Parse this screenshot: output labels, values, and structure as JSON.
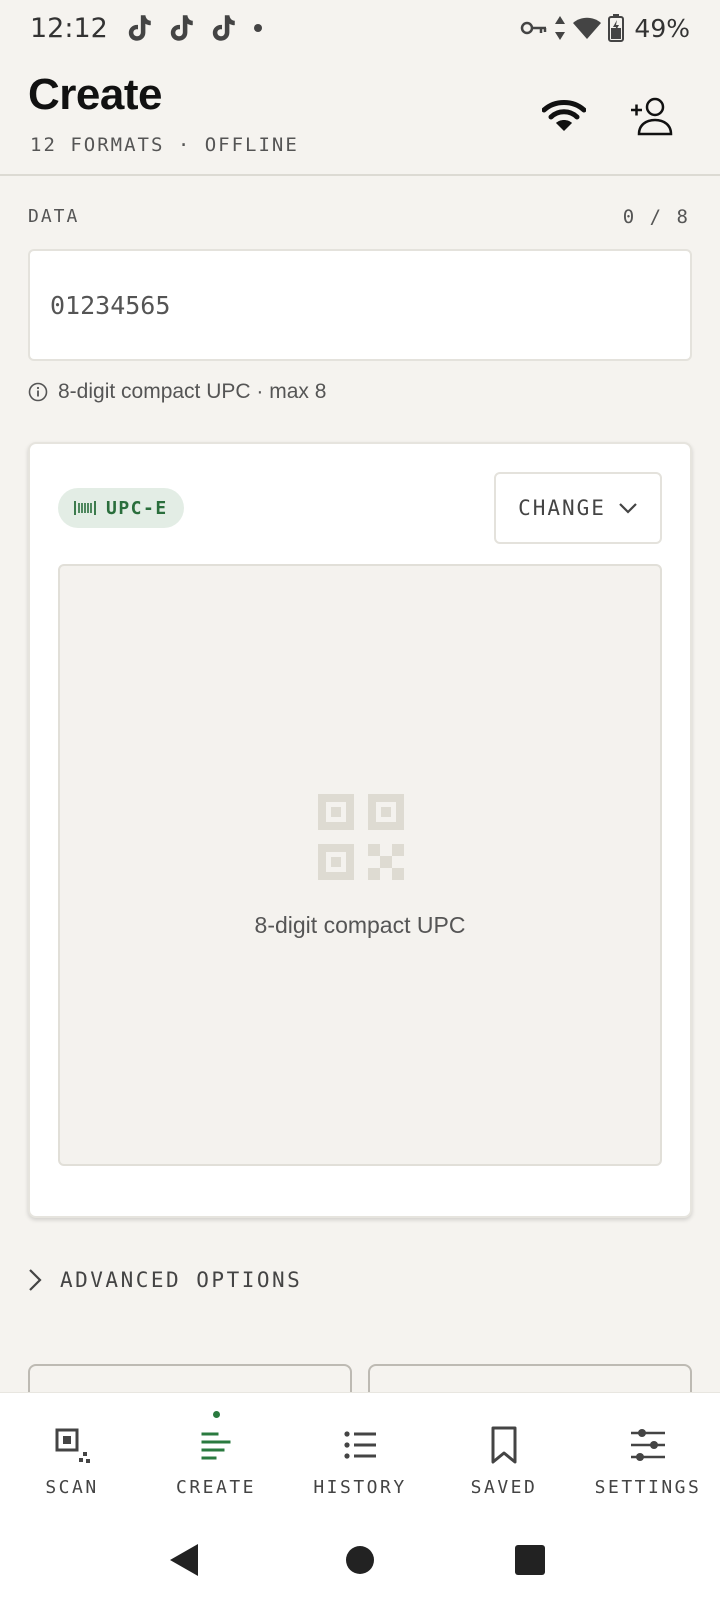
{
  "status_bar": {
    "time": "12:12",
    "notification_icons": [
      "tiktok-icon",
      "tiktok-icon",
      "tiktok-icon"
    ],
    "battery": "49%"
  },
  "header": {
    "title": "Create",
    "subtitle": "12 FORMATS · OFFLINE",
    "actions": [
      "wifi-icon",
      "add-user-icon"
    ]
  },
  "data_section": {
    "label": "DATA",
    "count": "0 / 8",
    "placeholder": "01234565",
    "hint": "8-digit compact UPC · max 8"
  },
  "preview": {
    "format": "UPC-E",
    "change_label": "CHANGE",
    "caption": "8-digit compact UPC"
  },
  "advanced": {
    "label": "ADVANCED OPTIONS"
  },
  "bottom_nav": {
    "items": [
      {
        "label": "SCAN",
        "icon": "scan-icon"
      },
      {
        "label": "CREATE",
        "icon": "create-icon",
        "active": true
      },
      {
        "label": "HISTORY",
        "icon": "history-icon"
      },
      {
        "label": "SAVED",
        "icon": "bookmark-icon"
      },
      {
        "label": "SETTINGS",
        "icon": "sliders-icon"
      }
    ]
  },
  "colors": {
    "accent": "#2a7a3f",
    "background": "#f5f3ef",
    "badge_bg": "#e3ede5"
  }
}
